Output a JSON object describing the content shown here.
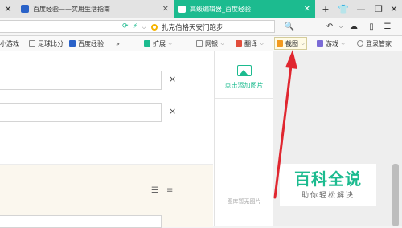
{
  "tabs": [
    {
      "title": "百度经验——实用生活指南"
    },
    {
      "title": "高级编辑器_百度经验"
    }
  ],
  "window": {
    "new_tab": "+",
    "minimize": "—",
    "restore": "❐",
    "close": "✕",
    "close_tab": "✕"
  },
  "address": {
    "search_text": "扎克伯格天安门跑步"
  },
  "bookmarks": [
    {
      "label": "小游戏"
    },
    {
      "label": "足球比分"
    },
    {
      "label": "百度经验"
    },
    {
      "label": "»"
    },
    {
      "label": "扩展"
    },
    {
      "label": "网银"
    },
    {
      "label": "翻译"
    },
    {
      "label": "截图"
    },
    {
      "label": "游戏"
    },
    {
      "label": "登录管家"
    }
  ],
  "editor": {
    "remove_symbol": "×"
  },
  "side_panel": {
    "add_image_label": "点击添加图片",
    "no_image_text": "图库暂无图片"
  },
  "watermark": {
    "title": "百科全说",
    "subtitle": "助你轻松解决"
  },
  "colors": {
    "accent": "#1cbb8f",
    "arrow": "#e0262f",
    "tab_active": "#1cbb8f"
  }
}
